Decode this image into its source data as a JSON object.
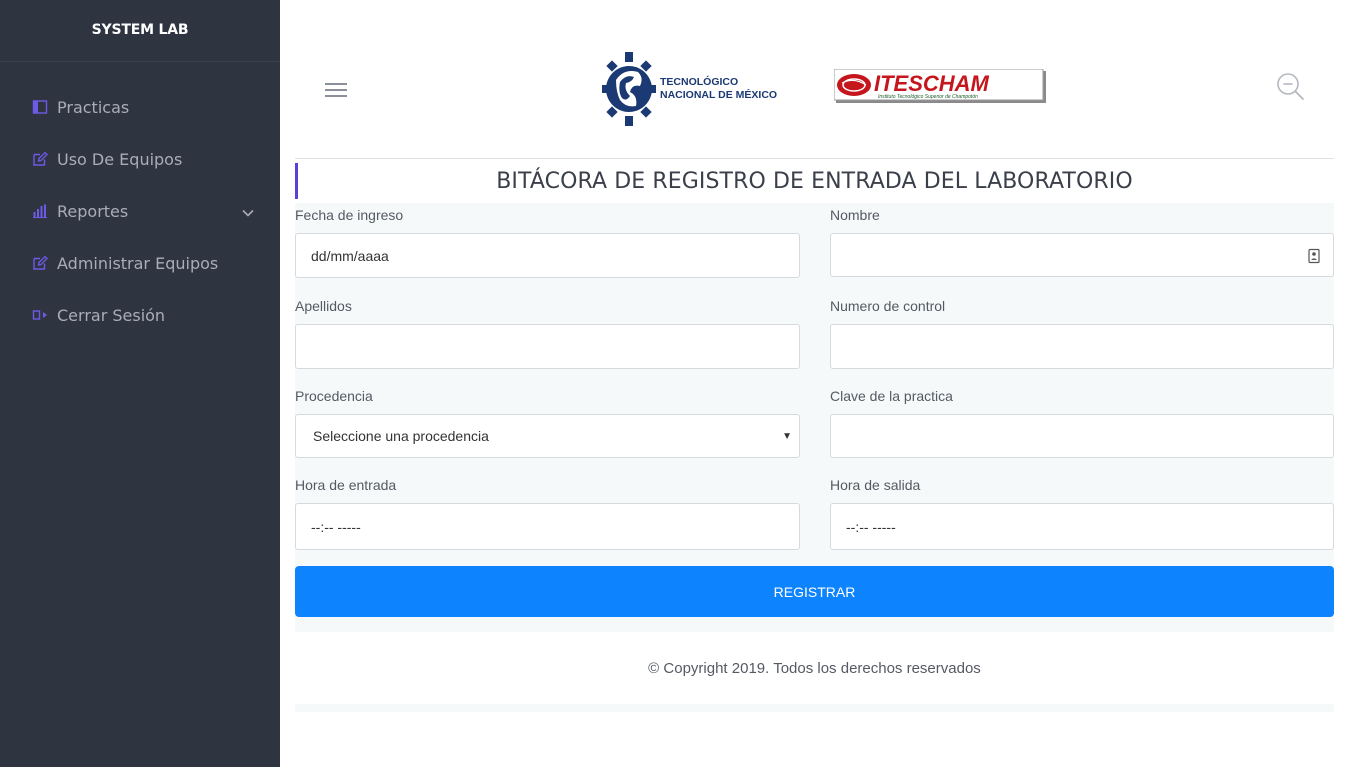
{
  "sidebar": {
    "brand": "SYSTEM LAB",
    "items": [
      {
        "label": "Practicas",
        "icon": "panel-icon"
      },
      {
        "label": "Uso De Equipos",
        "icon": "edit-icon"
      },
      {
        "label": "Reportes",
        "icon": "bar-chart-icon",
        "has_submenu": true
      },
      {
        "label": "Administrar Equipos",
        "icon": "edit-icon"
      },
      {
        "label": "Cerrar Sesión",
        "icon": "logout-icon"
      }
    ]
  },
  "header": {
    "logo_tec_line1": "TECNOLÓGICO",
    "logo_tec_line2": "NACIONAL DE MÉXICO",
    "logo_itescham_name": "ITESCHAM",
    "logo_itescham_sub": "Instituto Tecnológico Superior de Champotón"
  },
  "page": {
    "title": "BITÁCORA DE REGISTRO DE ENTRADA DEL LABORATORIO"
  },
  "form": {
    "fecha_label": "Fecha de ingreso",
    "fecha_value": "dd/mm/aaaa",
    "nombre_label": "Nombre",
    "apellidos_label": "Apellidos",
    "control_label": "Numero de control",
    "procedencia_label": "Procedencia",
    "procedencia_value": "Seleccione una procedencia",
    "clave_label": "Clave de la practica",
    "entrada_label": "Hora de entrada",
    "entrada_value": "--:-- -----",
    "salida_label": "Hora de salida",
    "salida_value": "--:-- -----",
    "submit_label": "REGISTRAR"
  },
  "footer": {
    "copyright": "© Copyright 2019. Todos los derechos reservados"
  },
  "colors": {
    "sidebar_bg": "#2f3441",
    "accent": "#5b3fd6",
    "primary_button": "#0d84fd",
    "panel_bg": "#f6f9fa",
    "itescham_red": "#c4161c",
    "tec_blue": "#1b3a73"
  }
}
